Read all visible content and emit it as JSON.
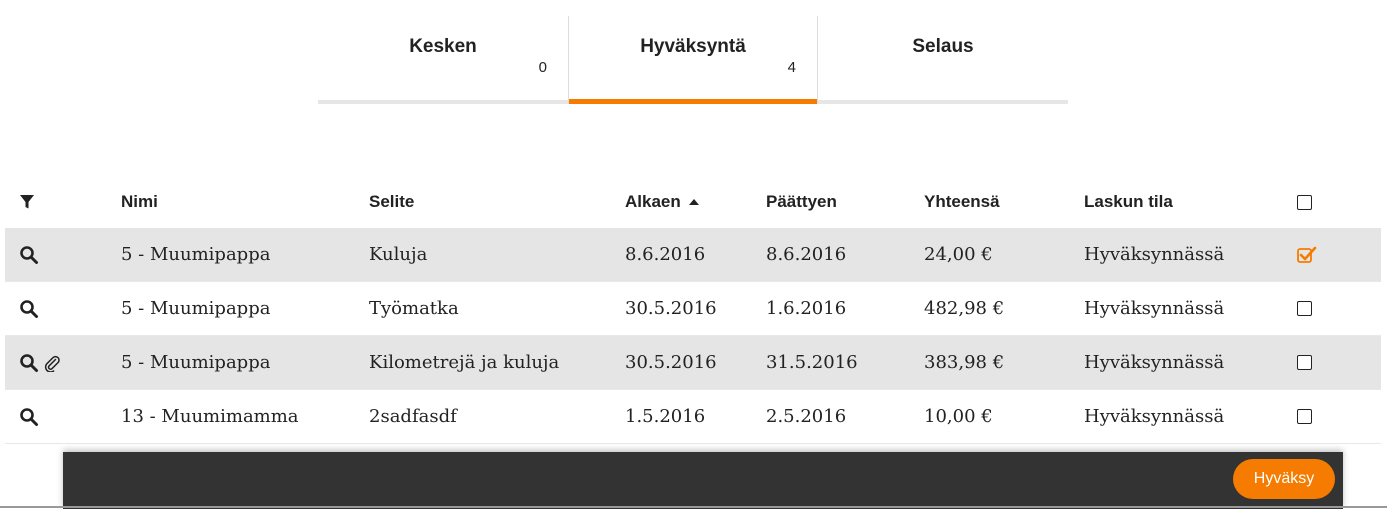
{
  "tabs": [
    {
      "title": "Kesken",
      "count": "0"
    },
    {
      "title": "Hyväksyntä",
      "count": "4",
      "active": true
    },
    {
      "title": "Selaus",
      "count": ""
    }
  ],
  "colors": {
    "accent": "#f57c00",
    "footer": "#333333",
    "row_shade": "#e5e5e5"
  },
  "table": {
    "headers": {
      "filter_icon": "filter-icon",
      "nimi": "Nimi",
      "selite": "Selite",
      "alkaen": "Alkaen",
      "paattyen": "Päättyen",
      "yhteensa": "Yhteensä",
      "tila": "Laskun tila"
    },
    "sort": {
      "column": "Alkaen",
      "direction": "ascending"
    },
    "rows": [
      {
        "nimi": "5 - Muumipappa",
        "selite": "Kuluja",
        "alkaen": "8.6.2016",
        "paattyen": "8.6.2016",
        "yhteensa": "24,00 €",
        "tila": "Hyväksynnässä",
        "checked": true,
        "attachment": false
      },
      {
        "nimi": "5 - Muumipappa",
        "selite": "Työmatka",
        "alkaen": "30.5.2016",
        "paattyen": "1.6.2016",
        "yhteensa": "482,98 €",
        "tila": "Hyväksynnässä",
        "checked": false,
        "attachment": false
      },
      {
        "nimi": "5 - Muumipappa",
        "selite": "Kilometrejä ja kuluja",
        "alkaen": "30.5.2016",
        "paattyen": "31.5.2016",
        "yhteensa": "383,98 €",
        "tila": "Hyväksynnässä",
        "checked": false,
        "attachment": true
      },
      {
        "nimi": "13 - Muumimamma",
        "selite": "2sadfasdf",
        "alkaen": "1.5.2016",
        "paattyen": "2.5.2016",
        "yhteensa": "10,00 €",
        "tila": "Hyväksynnässä",
        "checked": false,
        "attachment": false
      }
    ]
  },
  "footer": {
    "approve_label": "Hyväksy"
  }
}
